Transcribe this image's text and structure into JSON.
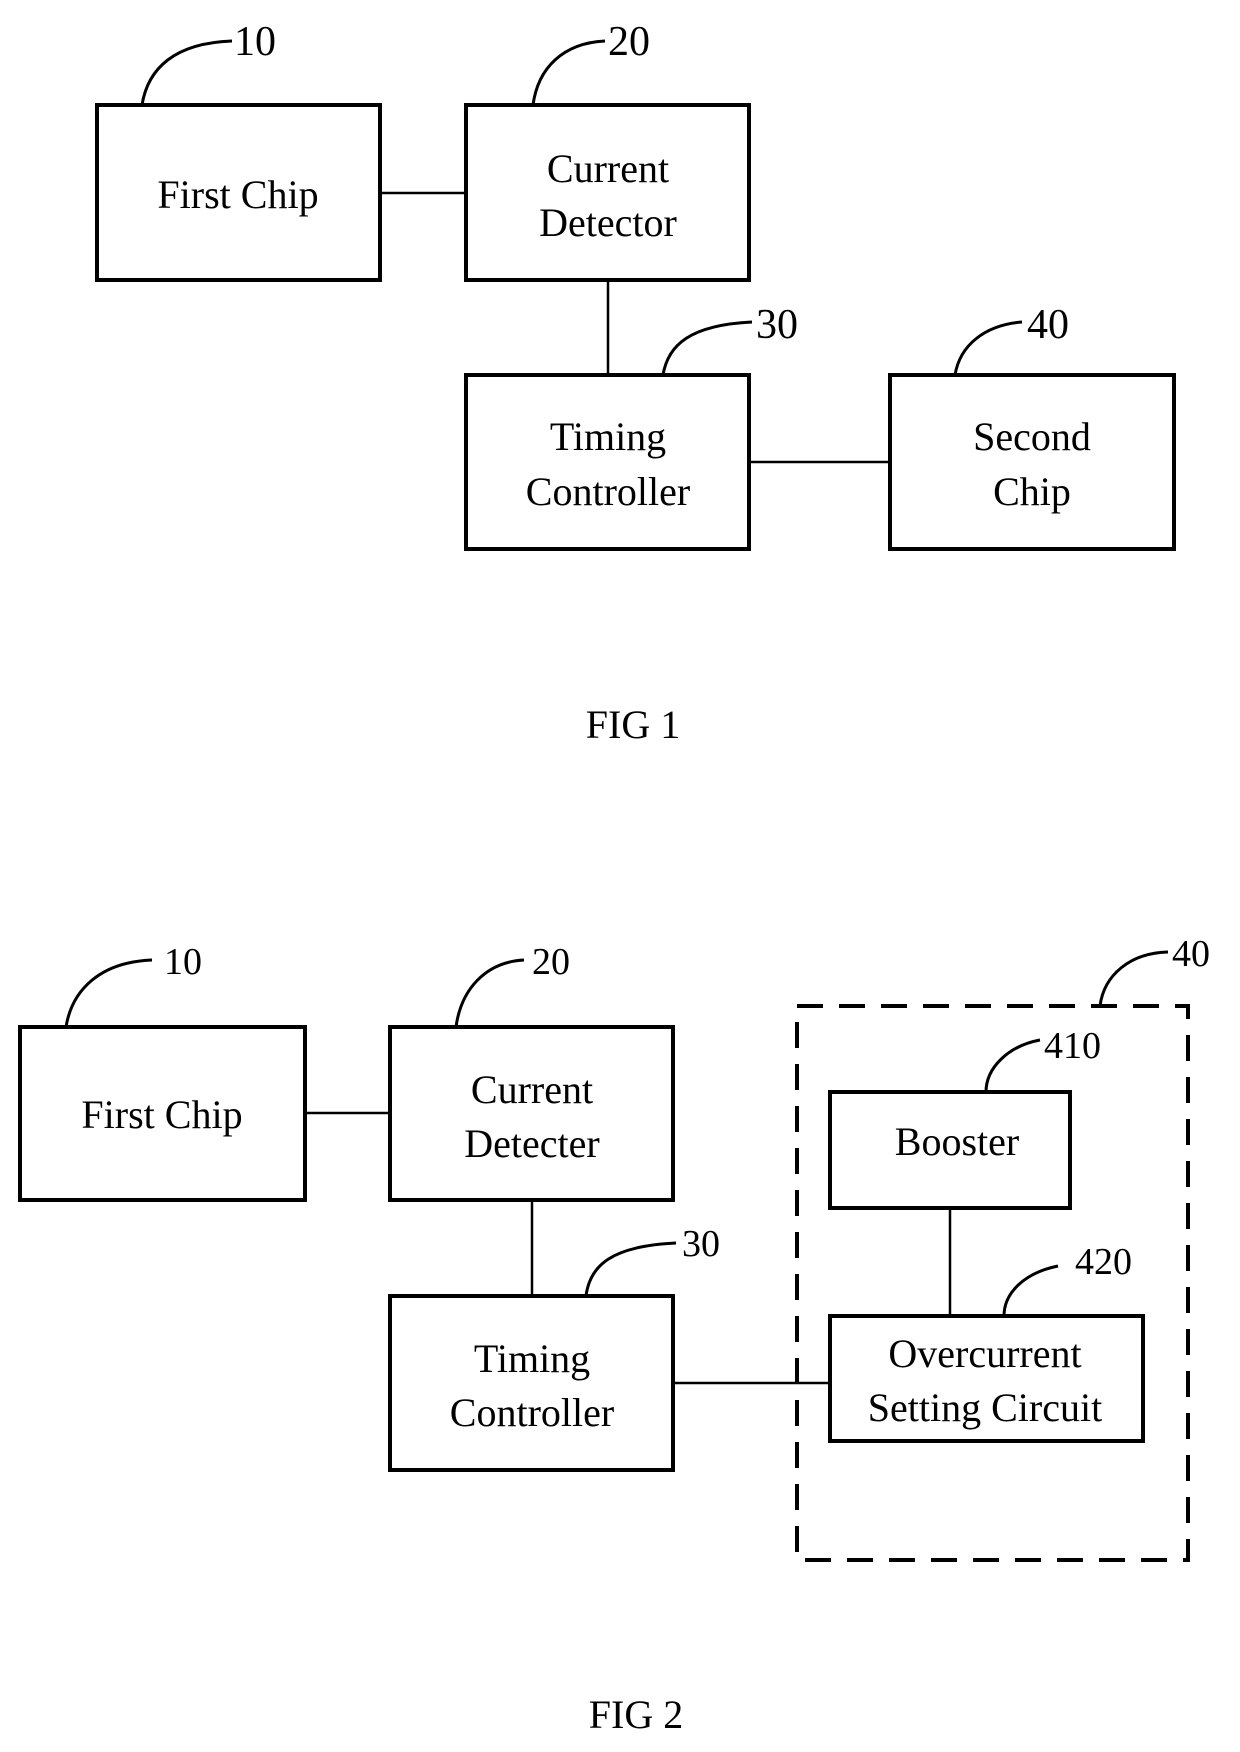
{
  "fig1": {
    "caption": "FIG 1",
    "blocks": {
      "first_chip": {
        "ref": "10",
        "lines": [
          "First Chip"
        ]
      },
      "current_detector": {
        "ref": "20",
        "lines": [
          "Current",
          "Detector"
        ]
      },
      "timing_controller": {
        "ref": "30",
        "lines": [
          "Timing",
          "Controller"
        ]
      },
      "second_chip": {
        "ref": "40",
        "lines": [
          "Second",
          "Chip"
        ]
      }
    },
    "connections": [
      [
        "first_chip",
        "current_detector"
      ],
      [
        "current_detector",
        "timing_controller"
      ],
      [
        "timing_controller",
        "second_chip"
      ]
    ]
  },
  "fig2": {
    "caption": "FIG 2",
    "blocks": {
      "first_chip": {
        "ref": "10",
        "lines": [
          "First Chip"
        ]
      },
      "current_detecter": {
        "ref": "20",
        "lines": [
          "Current",
          "Detecter"
        ]
      },
      "timing_controller": {
        "ref": "30",
        "lines": [
          "Timing",
          "Controller"
        ]
      },
      "second_chip_group": {
        "ref": "40"
      },
      "booster": {
        "ref": "410",
        "lines": [
          "Booster"
        ]
      },
      "overcurrent_setting_circuit": {
        "ref": "420",
        "lines": [
          "Overcurrent",
          "Setting Circuit"
        ]
      }
    },
    "connections": [
      [
        "first_chip",
        "current_detecter"
      ],
      [
        "current_detecter",
        "timing_controller"
      ],
      [
        "timing_controller",
        "overcurrent_setting_circuit"
      ],
      [
        "booster",
        "overcurrent_setting_circuit"
      ]
    ]
  }
}
